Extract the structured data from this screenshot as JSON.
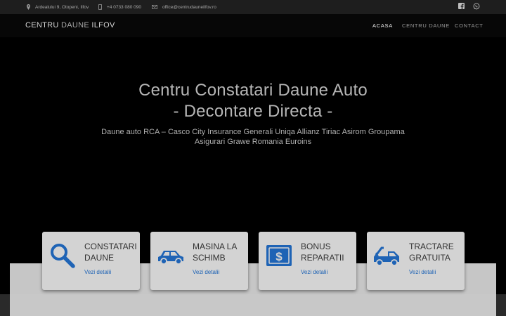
{
  "topbar": {
    "address": "Ardealului 9, Otopeni, Ilfov",
    "phone": "+4 0733 080 090",
    "email": "office@centrudauneilfov.ro",
    "social": [
      "facebook-icon",
      "whatsapp-icon"
    ]
  },
  "nav": {
    "brand_strong": "CENTRU",
    "brand_light": "DAUNE",
    "brand_end": "ILFOV",
    "menu": [
      "ACASA",
      "CENTRU DAUNE",
      "CONTACT"
    ],
    "active": "ACASA"
  },
  "hero": {
    "title_line1": "Centru Constatari Daune Auto",
    "title_line2": "- Decontare Directa -",
    "sub_line1": "Daune auto RCA – Casco City Insurance Generali Uniqa Allianz Tiriac Asirom Groupama",
    "sub_line2": "Asigurari Grawe Romania  Euroins"
  },
  "cards": [
    {
      "title_1": "CONSTATARI",
      "title_2": "DAUNE",
      "link": "Vezi detalii",
      "icon": "magnifier-icon"
    },
    {
      "title_1": "MASINA LA",
      "title_2": "SCHIMB",
      "link": "Vezi detalii",
      "icon": "car-icon"
    },
    {
      "title_1": "BONUS",
      "title_2": "REPARATII",
      "link": "Vezi detalii",
      "icon": "dollar-bill-icon"
    },
    {
      "title_1": "TRACTARE",
      "title_2": "GRATUITA",
      "link": "Vezi detalii",
      "icon": "tow-truck-icon"
    }
  ],
  "colors": {
    "accent_blue": "#1e63b5",
    "card_bg": "#d3d3d3",
    "topbar_bg": "#1e1e1e",
    "page_bg": "#000000"
  }
}
